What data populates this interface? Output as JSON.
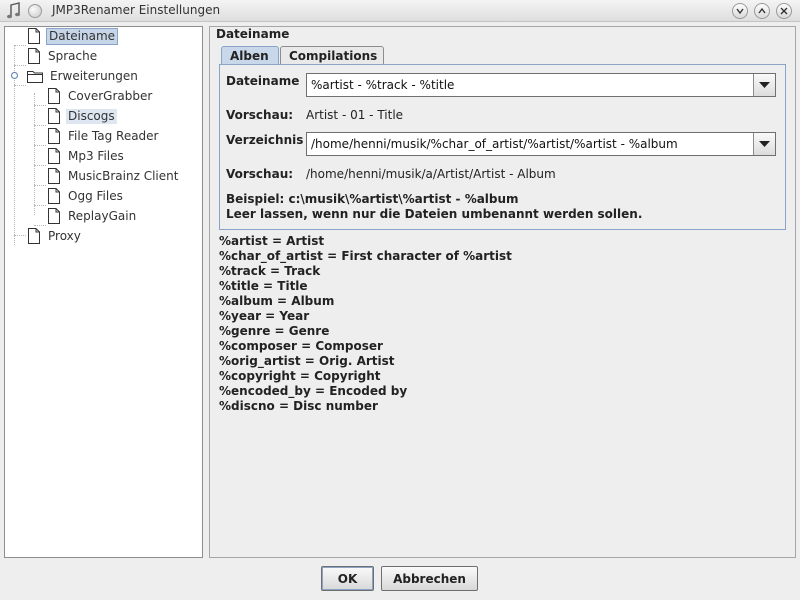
{
  "window": {
    "title": "JMP3Renamer Einstellungen"
  },
  "tree": {
    "items": [
      {
        "label": "Dateiname",
        "icon": "document-icon",
        "selected": true
      },
      {
        "label": "Sprache",
        "icon": "document-icon"
      },
      {
        "label": "Erweiterungen",
        "icon": "folder-icon",
        "expanded": true
      },
      {
        "label": "CoverGrabber",
        "icon": "document-icon"
      },
      {
        "label": "Discogs",
        "icon": "document-icon",
        "highlighted": true
      },
      {
        "label": "File Tag Reader",
        "icon": "document-icon"
      },
      {
        "label": "Mp3 Files",
        "icon": "document-icon"
      },
      {
        "label": "MusicBrainz Client",
        "icon": "document-icon"
      },
      {
        "label": "Ogg Files",
        "icon": "document-icon"
      },
      {
        "label": "ReplayGain",
        "icon": "document-icon"
      },
      {
        "label": "Proxy",
        "icon": "document-icon"
      }
    ]
  },
  "section": {
    "title": "Dateiname"
  },
  "tabs": [
    {
      "label": "Alben",
      "active": true
    },
    {
      "label": "Compilations"
    }
  ],
  "form": {
    "filename_label": "Dateiname",
    "filename_value": "%artist - %track - %title",
    "preview1_label": "Vorschau:",
    "preview1_value": "Artist - 01 - Title",
    "directory_label": "Verzeichnis",
    "directory_value": "/home/henni/musik/%char_of_artist/%artist/%artist - %album",
    "preview2_label": "Vorschau:",
    "preview2_value": "/home/henni/musik/a/Artist/Artist - Album",
    "example_line": "Beispiel: c:\\musik\\%artist\\%artist - %album",
    "hint_line": "Leer lassen, wenn nur die Dateien umbenannt werden sollen."
  },
  "placeholders": [
    "%artist = Artist",
    "%char_of_artist = First character of %artist",
    "%track = Track",
    "%title = Title",
    "%album = Album",
    "%year = Year",
    "%genre = Genre",
    "%composer = Composer",
    "%orig_artist = Orig. Artist",
    "%copyright = Copyright",
    "%encoded_by = Encoded by",
    "%discno = Disc number"
  ],
  "buttons": {
    "ok_label": "OK",
    "cancel_label": "Abbrechen"
  },
  "colors": {
    "selection": "#c6d5e8",
    "accent_border": "#8aa4c7",
    "window_bg": "#eeeeee"
  }
}
